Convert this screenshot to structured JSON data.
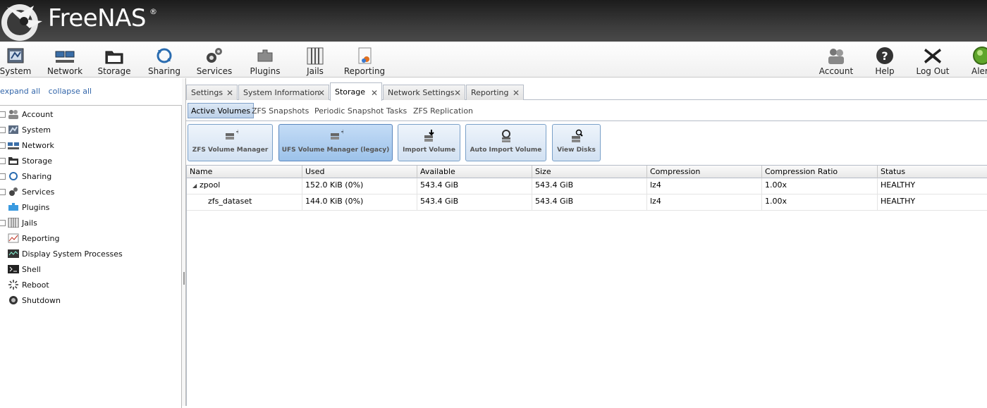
{
  "header": {
    "logo_text": "FreeNAS",
    "logo_mark": "®"
  },
  "toolbar": {
    "items": [
      {
        "label": "System",
        "icon": "system-icon"
      },
      {
        "label": "Network",
        "icon": "network-icon"
      },
      {
        "label": "Storage",
        "icon": "storage-icon"
      },
      {
        "label": "Sharing",
        "icon": "sharing-icon"
      },
      {
        "label": "Services",
        "icon": "services-icon"
      },
      {
        "label": "Plugins",
        "icon": "plugins-icon"
      },
      {
        "label": "Jails",
        "icon": "jails-icon"
      },
      {
        "label": "Reporting",
        "icon": "reporting-icon"
      }
    ],
    "right_items": [
      {
        "label": "Account",
        "icon": "account-icon"
      },
      {
        "label": "Help",
        "icon": "help-icon"
      },
      {
        "label": "Log Out",
        "icon": "logout-icon"
      },
      {
        "label": "Alert",
        "icon": "alert-icon"
      }
    ]
  },
  "left_panel": {
    "expand_all": "expand all",
    "collapse_all": "collapse all",
    "tree": [
      {
        "label": "Account",
        "expandable": true
      },
      {
        "label": "System",
        "expandable": true
      },
      {
        "label": "Network",
        "expandable": true
      },
      {
        "label": "Storage",
        "expandable": true
      },
      {
        "label": "Sharing",
        "expandable": true
      },
      {
        "label": "Services",
        "expandable": true
      },
      {
        "label": "Plugins",
        "expandable": false
      },
      {
        "label": "Jails",
        "expandable": true
      },
      {
        "label": "Reporting",
        "expandable": false
      },
      {
        "label": "Display System Processes",
        "expandable": false
      },
      {
        "label": "Shell",
        "expandable": false
      },
      {
        "label": "Reboot",
        "expandable": false
      },
      {
        "label": "Shutdown",
        "expandable": false
      }
    ]
  },
  "tabs": [
    {
      "label": "Settings",
      "active": false
    },
    {
      "label": "System Information",
      "active": false
    },
    {
      "label": "Storage",
      "active": true
    },
    {
      "label": "Network Settings",
      "active": false
    },
    {
      "label": "Reporting",
      "active": false
    }
  ],
  "subtabs": [
    {
      "label": "Active Volumes",
      "active": true
    },
    {
      "label": "ZFS Snapshots",
      "active": false
    },
    {
      "label": "Periodic Snapshot Tasks",
      "active": false
    },
    {
      "label": "ZFS Replication",
      "active": false
    }
  ],
  "actions": [
    {
      "label": "ZFS Volume Manager"
    },
    {
      "label": "UFS Volume Manager (legacy)"
    },
    {
      "label": "Import Volume"
    },
    {
      "label": "Auto Import Volume"
    },
    {
      "label": "View Disks"
    }
  ],
  "grid": {
    "columns": [
      "Name",
      "Used",
      "Available",
      "Size",
      "Compression",
      "Compression Ratio",
      "Status"
    ],
    "rows": [
      {
        "name": "zpool",
        "used": "152.0 KiB (0%)",
        "available": "543.4 GiB",
        "size": "543.4 GiB",
        "compression": "lz4",
        "ratio": "1.00x",
        "status": "HEALTHY",
        "expander": "◢"
      },
      {
        "name": "zfs_dataset",
        "used": "144.0 KiB (0%)",
        "available": "543.4 GiB",
        "size": "543.4 GiB",
        "compression": "lz4",
        "ratio": "1.00x",
        "status": "HEALTHY",
        "expander": ""
      }
    ]
  }
}
